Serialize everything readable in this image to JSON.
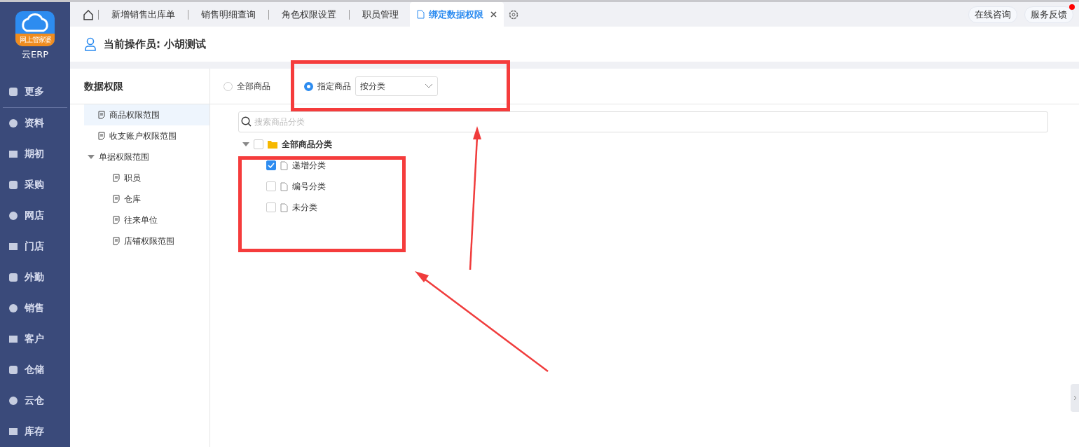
{
  "logo": {
    "badge": "网上管家婆",
    "product": "云ERP"
  },
  "nav": [
    {
      "label": "更多"
    },
    {
      "label": "资料"
    },
    {
      "label": "期初"
    },
    {
      "label": "采购"
    },
    {
      "label": "网店"
    },
    {
      "label": "门店"
    },
    {
      "label": "外勤"
    },
    {
      "label": "销售"
    },
    {
      "label": "客户"
    },
    {
      "label": "仓储"
    },
    {
      "label": "云仓"
    },
    {
      "label": "库存"
    }
  ],
  "tabs": [
    {
      "label": "新增销售出库单",
      "selected": false
    },
    {
      "label": "销售明细查询",
      "selected": false
    },
    {
      "label": "角色权限设置",
      "selected": false
    },
    {
      "label": "职员管理",
      "selected": false
    },
    {
      "label": "绑定数据权限",
      "selected": true,
      "closable": true
    }
  ],
  "top_buttons": [
    {
      "label": "在线咨询",
      "badge": false
    },
    {
      "label": "服务反馈",
      "badge": true
    }
  ],
  "operator": "当前操作员: 小胡测试",
  "panel_title": "数据权限",
  "perm_tree": [
    {
      "label": "商品权限范围",
      "selected": true
    },
    {
      "label": "收支账户权限范围",
      "selected": false
    },
    {
      "label": "单据权限范围",
      "selected": false,
      "expanded": true,
      "children": [
        {
          "label": "职员",
          "selected": false
        },
        {
          "label": "仓库",
          "selected": false
        },
        {
          "label": "往来单位",
          "selected": false
        },
        {
          "label": "店铺权限范围",
          "selected": false
        }
      ]
    }
  ],
  "scope": [
    {
      "label": "全部商品",
      "selected": false
    },
    {
      "label": "指定商品",
      "selected": true
    }
  ],
  "scope_select": "按分类",
  "search": {
    "placeholder": "搜索商品分类"
  },
  "category_tree": {
    "label": "全部商品分类",
    "checked": false,
    "expanded": true,
    "children": [
      {
        "label": "递增分类",
        "checked": true
      },
      {
        "label": "编号分类",
        "checked": false
      },
      {
        "label": "未分类",
        "checked": false
      }
    ]
  }
}
